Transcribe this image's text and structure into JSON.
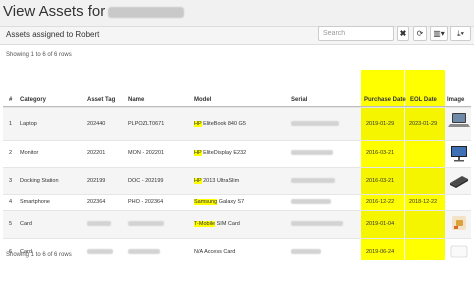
{
  "page": {
    "title_prefix": "View Assets for"
  },
  "panel": {
    "heading": "Assets assigned to Robert"
  },
  "toolbar": {
    "search_placeholder": "Search",
    "clear_glyph": "✖",
    "refresh_glyph": "⟳",
    "columns_glyph": "▥▾",
    "export_glyph": "⤓▾"
  },
  "rows_info_top": "Showing 1 to 6 of 6 rows",
  "rows_info_bottom": "Showing 1 to 6 of 6 rows",
  "highlight_color": "#ffff00",
  "table": {
    "headers": {
      "num": "#",
      "category": "Category",
      "asset_tag": "Asset Tag",
      "name": "Name",
      "model": "Model",
      "serial": "Serial",
      "purchase_date": "Purchase Date",
      "eol_date": "EOL Date",
      "image": "Image"
    },
    "rows": [
      {
        "num": "1",
        "category": "Laptop",
        "asset_tag": "202440",
        "name": "PLPOZLT0671",
        "model_brand": "HP",
        "model_rest": " EliteBook 840 G5",
        "purchase_date": "2019-01-29",
        "eol_date": "2023-01-29",
        "image_icon": "laptop-icon"
      },
      {
        "num": "2",
        "category": "Monitor",
        "asset_tag": "202201",
        "name": "MON - 202201",
        "model_brand": "HP",
        "model_rest": " EliteDisplay E232",
        "purchase_date": "2016-03-21",
        "eol_date": "",
        "image_icon": "monitor-icon"
      },
      {
        "num": "3",
        "category": "Docking Station",
        "asset_tag": "202199",
        "name": "DOC - 202199",
        "model_brand": "HP",
        "model_rest": " 2013 UltraSlim",
        "purchase_date": "2016-03-21",
        "eol_date": "",
        "image_icon": "docking-station-icon"
      },
      {
        "num": "4",
        "category": "Smartphone",
        "asset_tag": "202364",
        "name": "PHO - 202364",
        "model_brand": "Samsung",
        "model_rest": " Galaxy S7",
        "purchase_date": "2016-12-22",
        "eol_date": "2018-12-22",
        "image_icon": ""
      },
      {
        "num": "5",
        "category": "Card",
        "asset_tag": "",
        "name": "",
        "model_brand": "T-Mobile",
        "model_rest": " SIM Card",
        "purchase_date": "2019-01-04",
        "eol_date": "",
        "image_icon": "sim-card-icon"
      },
      {
        "num": "6",
        "category": "Card",
        "asset_tag": "",
        "name": "",
        "model_brand": "",
        "model_rest": "N/A Access Card",
        "purchase_date": "2019-06-24",
        "eol_date": "",
        "image_icon": "access-card-icon"
      }
    ]
  }
}
